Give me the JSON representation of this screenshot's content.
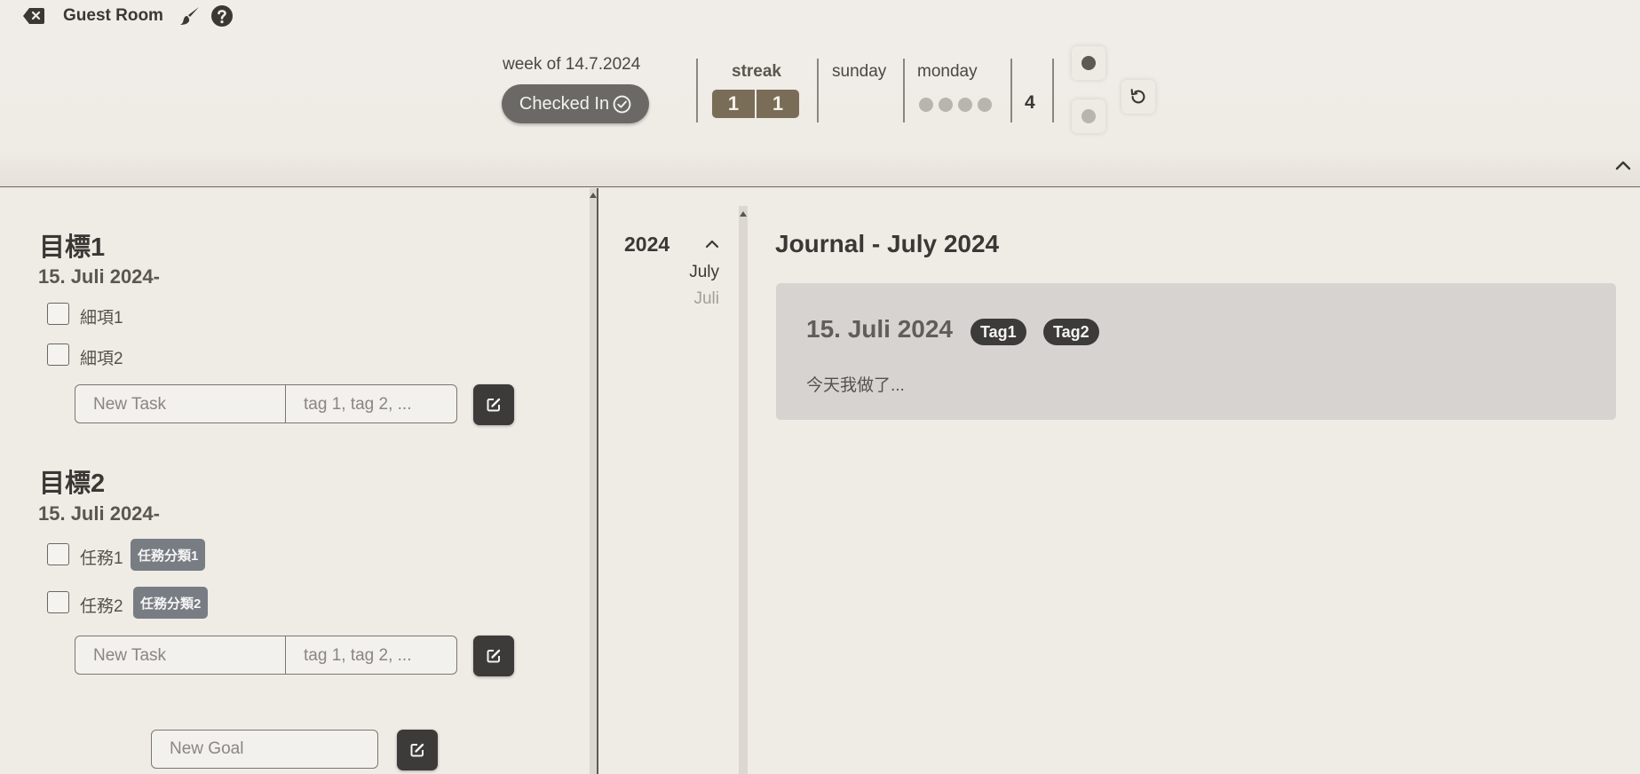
{
  "app": {
    "title": "Guest Room"
  },
  "header": {
    "week_label": "week of 14.7.2024",
    "checkin_label": "Checked In",
    "streak_label": "streak",
    "streak_values": [
      "1",
      "1"
    ],
    "days": [
      "sunday",
      "monday"
    ],
    "monday_dots": 4,
    "count": "4"
  },
  "goals": [
    {
      "title": "目標1",
      "date": "15. Juli 2024-",
      "tasks": [
        {
          "label": "細項1",
          "tag": null
        },
        {
          "label": "細項2",
          "tag": null
        }
      ],
      "new_task_placeholder": "New Task",
      "tags_placeholder": "tag 1, tag 2, ..."
    },
    {
      "title": "目標2",
      "date": "15. Juli 2024-",
      "tasks": [
        {
          "label": "任務1",
          "tag": "任務分類1"
        },
        {
          "label": "任務2",
          "tag": "任務分類2"
        }
      ],
      "new_task_placeholder": "New Task",
      "tags_placeholder": "tag 1, tag 2, ..."
    }
  ],
  "new_goal_placeholder": "New Goal",
  "nav": {
    "year": "2024",
    "months": [
      {
        "label": "July",
        "color": "#3a3835"
      },
      {
        "label": "Juli",
        "color": "#a29e98"
      }
    ]
  },
  "journal": {
    "title": "Journal - July 2024",
    "entries": [
      {
        "date": "15. Juli 2024",
        "tags": [
          "Tag1",
          "Tag2"
        ],
        "text": "今天我做了..."
      }
    ]
  }
}
